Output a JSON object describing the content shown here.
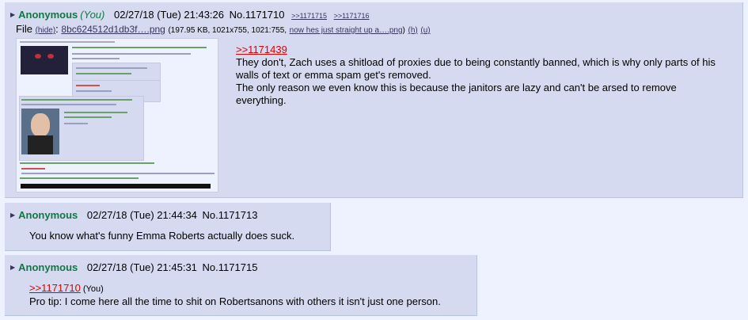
{
  "posts": [
    {
      "name": "Anonymous",
      "you": "(You)",
      "datetime": "02/27/18 (Tue) 21:43:26",
      "number": "No.1171710",
      "backlinks": [
        ">>1171715",
        ">>1171716"
      ],
      "file": {
        "label": "File",
        "hide": "(hide)",
        "filename": "8bc624512d1db3f….png",
        "meta": "(197.95 KB, 1021x755, 1021:755,",
        "orig_name": "now hes just straight up a….png",
        "close": ")",
        "h": "(h)",
        "u": "(u)"
      },
      "quote": ">>1171439",
      "lines": [
        "They don't, Zach uses a shitload of proxies due to being constantly banned, which is why only parts of his walls of text or emma spam get's removed.",
        "The only reason we even know this is because the janitors are lazy and can't be arsed to remove everything."
      ]
    },
    {
      "name": "Anonymous",
      "datetime": "02/27/18 (Tue) 21:44:34",
      "number": "No.1171713",
      "text": "You know what's funny Emma Roberts actually does suck."
    },
    {
      "name": "Anonymous",
      "datetime": "02/27/18 (Tue) 21:45:31",
      "number": "No.1171715",
      "quote": ">>1171710",
      "quote_you": "(You)",
      "text": "Pro tip: I come here all the time to shit on Robertsanons with others it isn't just one person."
    }
  ],
  "colors": {
    "page_bg": "#eef2ff",
    "post_bg": "#d6daf0",
    "name": "#117743",
    "quote": "#dd0000",
    "link": "#34345c"
  }
}
